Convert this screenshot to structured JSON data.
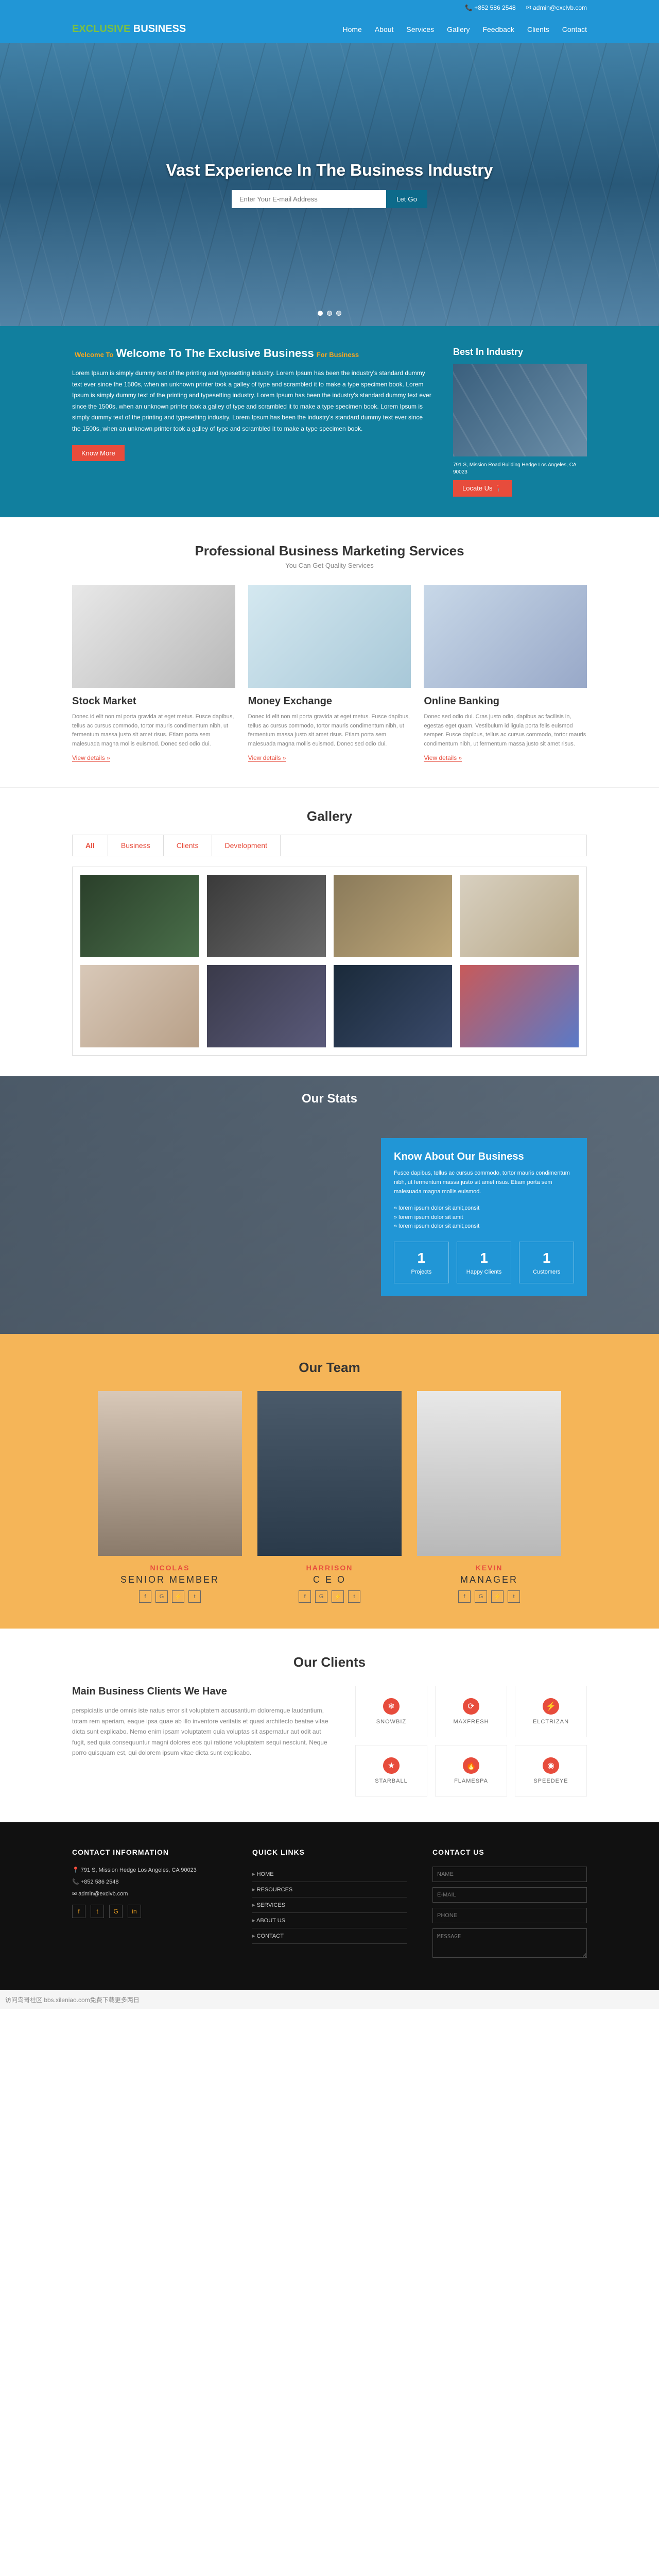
{
  "topbar": {
    "phone": "+852 586 2548",
    "email": "admin@exclvb.com"
  },
  "logo": {
    "part1": "EXCLUSIVE",
    "part2": "BUSINESS"
  },
  "nav": [
    "Home",
    "About",
    "Services",
    "Gallery",
    "Feedback",
    "Clients",
    "Contact"
  ],
  "hero": {
    "title": "Vast Experience In The Business Industry",
    "placeholder": "Enter Your E-mail Address",
    "button": "Let Go"
  },
  "welcome": {
    "badge1": "Welcome To",
    "title": "Welcome To The Exclusive Business",
    "badge2": "For Business",
    "text": "Lorem Ipsum is simply dummy text of the printing and typesetting industry. Lorem Ipsum has been the industry's standard dummy text ever since the 1500s, when an unknown printer took a galley of type and scrambled it to make a type specimen book. Lorem Ipsum is simply dummy text of the printing and typesetting industry. Lorem Ipsum has been the industry's standard dummy text ever since the 1500s, when an unknown printer took a galley of type and scrambled it to make a type specimen book. Lorem Ipsum is simply dummy text of the printing and typesetting industry. Lorem Ipsum has been the industry's standard dummy text ever since the 1500s, when an unknown printer took a galley of type and scrambled it to make a type specimen book.",
    "btn": "Know More",
    "side_title": "Best In Industry",
    "addr": "791 S, Mission Road Building Hedge Los Angeles, CA 90023",
    "locate": "Locate Us 📍"
  },
  "services": {
    "title": "Professional Business Marketing Services",
    "sub": "You Can Get Quality Services",
    "items": [
      {
        "title": "Stock Market",
        "text": "Donec id elit non mi porta gravida at eget metus. Fusce dapibus, tellus ac cursus commodo, tortor mauris condimentum nibh, ut fermentum massa justo sit amet risus. Etiam porta sem malesuada magna mollis euismod. Donec sed odio dui.",
        "link": "View details »"
      },
      {
        "title": "Money Exchange",
        "text": "Donec id elit non mi porta gravida at eget metus. Fusce dapibus, tellus ac cursus commodo, tortor mauris condimentum nibh, ut fermentum massa justo sit amet risus. Etiam porta sem malesuada magna mollis euismod. Donec sed odio dui.",
        "link": "View details »"
      },
      {
        "title": "Online Banking",
        "text": "Donec sed odio dui. Cras justo odio, dapibus ac facilisis in, egestas eget quam. Vestibulum id ligula porta felis euismod semper. Fusce dapibus, tellus ac cursus commodo, tortor mauris condimentum nibh, ut fermentum massa justo sit amet risus.",
        "link": "View details »"
      }
    ]
  },
  "gallery": {
    "title": "Gallery",
    "tabs": [
      "All",
      "Business",
      "Clients",
      "Development"
    ]
  },
  "stats": {
    "title": "Our Stats",
    "box_title": "Know About Our Business",
    "p1": "Fusce dapibus, tellus ac cursus commodo, tortor mauris condimentum nibh, ut fermentum massa justo sit amet risus. Etiam porta sem malesuada magna mollis euismod.",
    "p2": "» lorem ipsum dolor sit amit,consit\n» lorem ipsum dolor sit amit\n» lorem ipsum dolor sit amit,consit",
    "items": [
      {
        "num": "1",
        "label": "Projects"
      },
      {
        "num": "1",
        "label": "Happy Clients"
      },
      {
        "num": "1",
        "label": "Customers"
      }
    ]
  },
  "team": {
    "title": "Our Team",
    "members": [
      {
        "name": "NICOLAS",
        "role": "SENIOR MEMBER"
      },
      {
        "name": "HARRISON",
        "role": "C E O"
      },
      {
        "name": "KEVIN",
        "role": "MANAGER"
      }
    ]
  },
  "clients": {
    "title": "Our Clients",
    "sub": "Main Business Clients We Have",
    "text": "perspiciatis unde omnis iste natus error sit voluptatem accusantium doloremque laudantium, totam rem aperiam, eaque ipsa quae ab illo inventore veritatis et quasi architecto beatae vitae dicta sunt explicabo. Nemo enim ipsam voluptatem quia voluptas sit aspernatur aut odit aut fugit, sed quia consequuntur magni dolores eos qui ratione voluptatem sequi nesciunt. Neque porro quisquam est, qui dolorem ipsum vitae dicta sunt explicabo.",
    "items": [
      {
        "icon": "❄",
        "name": "SNOWBIZ"
      },
      {
        "icon": "⟳",
        "name": "MAXFRESH"
      },
      {
        "icon": "⚡",
        "name": "ELCTRIZAN"
      },
      {
        "icon": "★",
        "name": "STARBALL"
      },
      {
        "icon": "🔥",
        "name": "FLAMESPA"
      },
      {
        "icon": "◉",
        "name": "SPEEDEYE"
      }
    ]
  },
  "footer": {
    "c1": {
      "title": "CONTACT INFORMATION",
      "addr": "📍 791 S, Mission Hedge Los Angeles, CA 90023",
      "phone": "📞 +852 586 2548",
      "email": "✉ admin@exclvb.com"
    },
    "c2": {
      "title": "QUICK LINKS",
      "items": [
        "HOME",
        "RESOURCES",
        "SERVICES",
        "ABOUT US",
        "CONTACT"
      ]
    },
    "c3": {
      "title": "CONTACT US",
      "ph_name": "NAME",
      "ph_email": "E-MAIL",
      "ph_phone": "PHONE",
      "ph_msg": "MESSAGE"
    }
  },
  "bottom": "访问鸟哥社区 bbs.xileniao.com免费下载更多两日"
}
